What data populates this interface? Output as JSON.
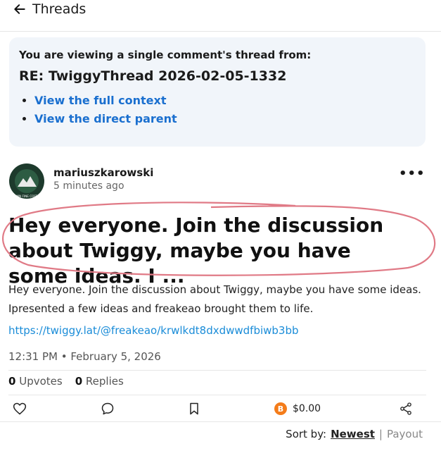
{
  "header": {
    "title": "Threads"
  },
  "notice": {
    "lead": "You are viewing a single comment's thread from:",
    "title": "RE: TwiggyThread 2026-02-05-1332",
    "links": [
      "View the full context",
      "View the direct parent"
    ]
  },
  "post": {
    "avatar_text": "DAMN FINE COFFEE",
    "author": "mariuszkarowski",
    "time": "5 minutes ago",
    "more": "•••",
    "headline": "Hey everyone. Join the discussion about Twiggy, maybe you have some ideas. I ...",
    "body": "Hey everyone. Join the discussion about Twiggy, maybe you have some ideas. Ipresented a few ideas and freakeao brought them to life.",
    "link": "https://twiggy.lat/@freakeao/krwlkdt8dxdwwdfbiwb3bb",
    "date": "12:31 PM • February 5, 2026",
    "upvotes_count": "0",
    "upvotes_label": "Upvotes",
    "replies_count": "0",
    "replies_label": "Replies",
    "payout": "$0.00",
    "payout_icon": "B"
  },
  "sort": {
    "label": "Sort by:",
    "active": "Newest",
    "separator": "|",
    "other": "Payout"
  },
  "colors": {
    "link": "#1a6fcf",
    "panel_bg": "#f1f5fa",
    "annotation": "#e07a86",
    "btc": "#f47c1a"
  }
}
